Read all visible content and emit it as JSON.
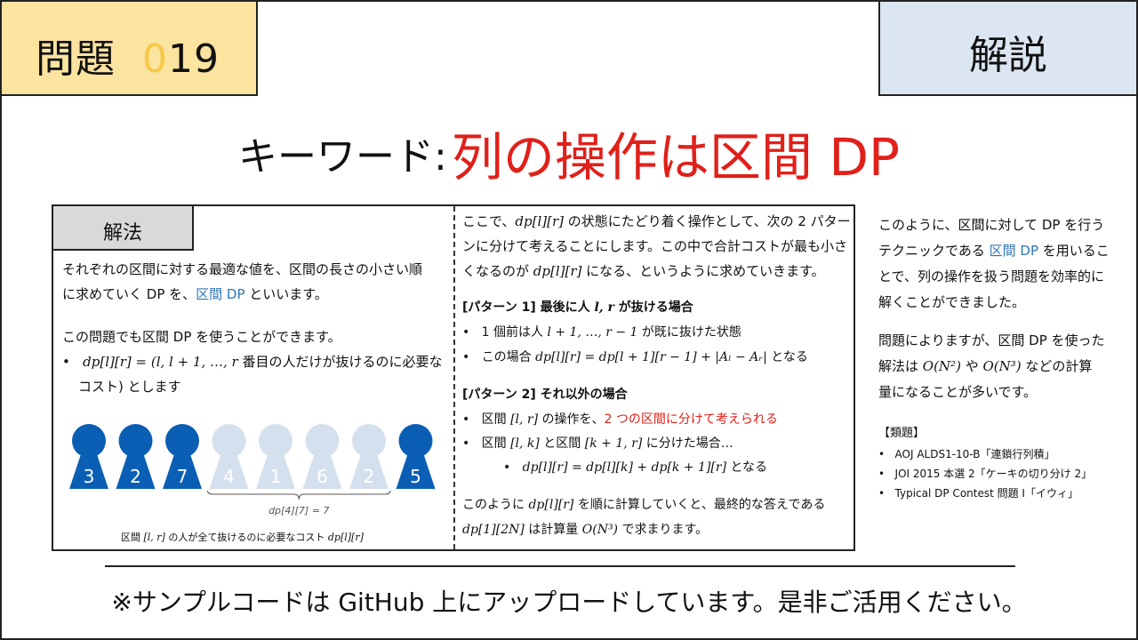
{
  "header": {
    "problem_prefix": "問題",
    "problem_zero": "0",
    "problem_number": "19",
    "section": "解説"
  },
  "headline": {
    "keyword_label": "キーワード:",
    "title": "列の操作は区間 DP"
  },
  "method": {
    "tab": "解法",
    "line1": "それぞれの区間に対する最適な値を、区間の長さの小さい順",
    "line2_a": "に求めていく DP を、",
    "line2_term": "区間 DP",
    "line2_b": " といいます。",
    "line3": "この問題でも区間 DP を使うことができます。",
    "bullet1_math": "dp[l][r] = (l, l + 1, …, r",
    "bullet1_text": " 番目の人だけが抜けるのに必要な",
    "bullet1_line2": "コスト) とします",
    "figure": {
      "numbers": [
        "3",
        "2",
        "7",
        "4",
        "1",
        "6",
        "2",
        "5"
      ],
      "active": [
        true,
        true,
        true,
        false,
        false,
        false,
        false,
        true
      ],
      "colors": {
        "active": "#0a5fb4",
        "faded": "#d5e0ef"
      },
      "brace_label": "dp[4][7] = 7",
      "caption_a": "区間 ",
      "caption_math": "[l, r]",
      "caption_b": " の人が全て抜けるのに必要なコスト ",
      "caption_math2": "dp[l][r]"
    }
  },
  "middle": {
    "p1_a": "ここで、",
    "p1_math": "dp[l][r]",
    "p1_b": " の状態にたどり着く操作として、次の 2 パター",
    "p1_line2": "ンに分けて考えることにします。この中で合計コストが最も小さ",
    "p1_line3_a": "くなるのが ",
    "p1_line3_math": "dp[l][r]",
    "p1_line3_b": " になる、というように求めていきます。",
    "pattern1_a": "[パターン 1] 最後に人 ",
    "pattern1_math": "l, r",
    "pattern1_b": " が抜ける場合",
    "p1_b1_a": "1 個前は人 ",
    "p1_b1_math": "l + 1, …, r − 1",
    "p1_b1_b": " が既に抜けた状態",
    "p1_b2_a": "この場合 ",
    "p1_b2_math": "dp[l][r] = dp[l + 1][r − 1] + |Aₗ − Aᵣ|",
    "p1_b2_b": " となる",
    "pattern2": "[パターン 2] それ以外の場合",
    "p2_b1_a": "区間 ",
    "p2_b1_math": "[l, r]",
    "p2_b1_b": " の操作を、",
    "p2_b1_red": "2 つの区間に分けて考えられる",
    "p2_b2_a": "区間 ",
    "p2_b2_math1": "[l, k]",
    "p2_b2_b": " と区間 ",
    "p2_b2_math2": "[k + 1, r]",
    "p2_b2_c": " に分けた場合…",
    "p2_b3_math": "dp[l][r] = dp[l][k] + dp[k + 1][r]",
    "p2_b3_b": " となる",
    "last_a": "このように ",
    "last_math": "dp[l][r]",
    "last_b": " を順に計算していくと、最終的な答えである",
    "last2_math": "dp[1][2N]",
    "last2_b": " は計算量 ",
    "last2_math2": "O(N³)",
    "last2_c": " で求まります。"
  },
  "right": {
    "l1": "このように、区間に対して DP を行う",
    "l2_a": "テクニックである ",
    "l2_term": "区間 DP",
    "l2_b": " を用いるこ",
    "l3": "とで、列の操作を扱う問題を効率的に",
    "l4": "解くことができました。",
    "l5": "問題によりますが、区間 DP を使った",
    "l6_a": "解法は ",
    "l6_m1": "O(N²)",
    "l6_b": " や ",
    "l6_m2": "O(N³)",
    "l6_c": " などの計算",
    "l7": "量になることが多いです。",
    "related_title": "【類題】",
    "related": [
      "AOJ ALDS1-10-B「連鎖行列積」",
      "JOI 2015 本選 2「ケーキの切り分け 2」",
      "Typical DP Contest 問題 I「イウィ」"
    ]
  },
  "footer": "※サンプルコードは GitHub 上にアップロードしています。是非ご活用ください。"
}
